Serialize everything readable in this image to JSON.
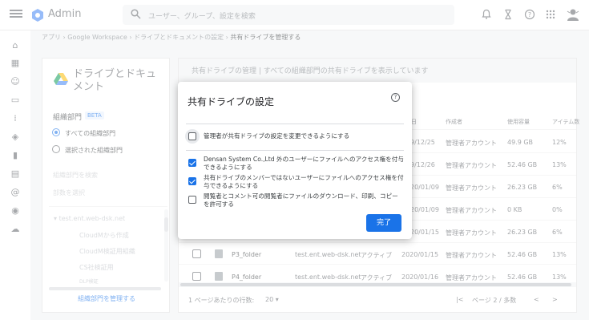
{
  "app": {
    "title": "Admin"
  },
  "search": {
    "placeholder": "ユーザー、グループ、設定を検索"
  },
  "breadcrumb": {
    "items": [
      "アプリ",
      "Google Workspace",
      "ドライブとドキュメントの設定"
    ],
    "current": "共有ドライブを管理する",
    "separator": "›"
  },
  "left_panel": {
    "title": "ドライブとドキュメント",
    "ou_label": "組織部門",
    "beta": "BETA",
    "radio_all": "すべての組織部門",
    "radio_selected": "選択された組織部門",
    "search_ou": "組織部門を検索",
    "select_ou": "部数を選択",
    "tree": [
      "test.ent.web-dsk.net",
      "CloudMから作成",
      "CloudM検証用組織",
      "CS社検証用",
      "DLP検証"
    ],
    "manage_link": "組織部門を管理する"
  },
  "main": {
    "header_title": "共有ドライブの管理",
    "header_sub": "すべての組織部門の共有ドライブを表示しています",
    "columns": [
      "日",
      "作成者",
      "使用容量",
      "アイテム数"
    ],
    "rows": [
      {
        "date": "9/12/25",
        "creator": "管理者アカウント",
        "size": "49.9 GB",
        "items": "12%"
      },
      {
        "date": "9/12/26",
        "creator": "管理者アカウント",
        "size": "52.46 GB",
        "items": "13%"
      },
      {
        "date": "20/01/09",
        "creator": "管理者アカウント",
        "size": "26.23 GB",
        "items": "6%"
      },
      {
        "date": "20/01/09",
        "creator": "管理者アカウント",
        "size": "0 KB",
        "items": "0%"
      },
      {
        "date": "20/01/15",
        "creator": "管理者アカウント",
        "size": "26.23 GB",
        "items": "6%"
      }
    ],
    "full_rows": [
      {
        "name": "P3_folder",
        "domain": "test.ent.web-dsk.net",
        "status": "アクティブ",
        "date": "2020/01/15",
        "creator": "管理者アカウント",
        "size": "52.46 GB",
        "items": "13%"
      },
      {
        "name": "P4_folder",
        "domain": "test.ent.web-dsk.net",
        "status": "アクティブ",
        "date": "2020/01/16",
        "creator": "管理者アカウント",
        "size": "52.46 GB",
        "items": "13%"
      }
    ],
    "rows_per_page_label": "1 ページあたりの行数:",
    "rows_per_page": "20",
    "page_label": "ページ 2 / 多数"
  },
  "dialog": {
    "title": "共有ドライブの設定",
    "help": "?",
    "options": [
      {
        "label": "管理者が共有ドライブの設定を変更できるようにする",
        "checked": false
      },
      {
        "label": "Densan System Co.,Ltd 外のユーザーにファイルへのアクセス権を付与できるようにする",
        "checked": true
      },
      {
        "label": "共有ドライブのメンバーではないユーザーにファイルへのアクセス権を付与できるようにする",
        "checked": true
      },
      {
        "label": "閲覧者とコメント可の閲覧者にファイルのダウンロード、印刷、コピーを許可する",
        "checked": false
      }
    ],
    "done": "完了"
  },
  "colors": {
    "accent": "#1a73e8",
    "overlay": "rgba(255,255,255,0.45)"
  }
}
